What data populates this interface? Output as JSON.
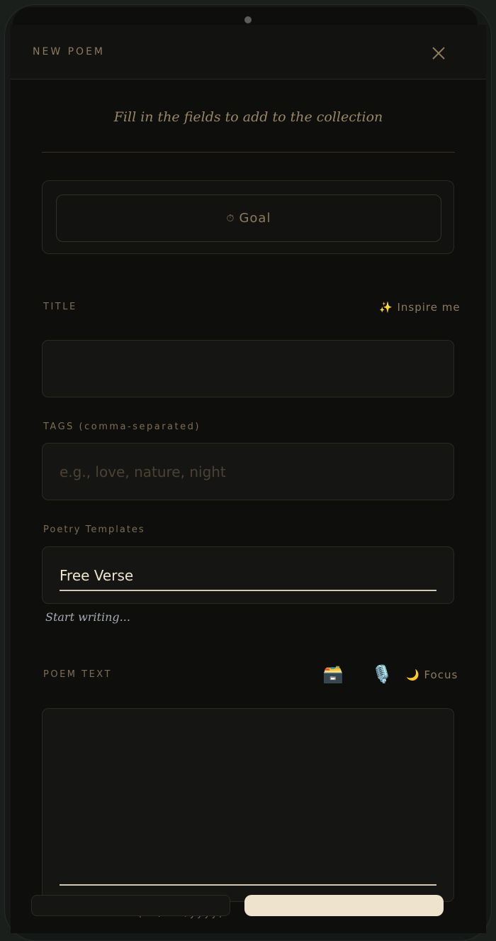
{
  "header": {
    "title": "NEW POEM",
    "close_icon": "close-icon"
  },
  "subtitle": "Fill in the fields to add to the collection",
  "goal": {
    "label": "Goal",
    "icon": "timer-icon",
    "glyph": "⏱"
  },
  "title_field": {
    "label": "TITLE",
    "value": "",
    "placeholder": "",
    "inspire_label": "Inspire me",
    "inspire_glyph": "✨"
  },
  "tags_field": {
    "label": "TAGS (comma-separated)",
    "value": "",
    "placeholder": "e.g., love, nature, night"
  },
  "templates": {
    "label": "Poetry Templates",
    "selected": "Free Verse",
    "hint": "Start writing..."
  },
  "poem_text": {
    "label": "POEM TEXT",
    "archive_glyph": "🗃️",
    "mic_glyph": "🎙️",
    "focus_glyph": "🌙",
    "focus_label": "Focus",
    "value": ""
  },
  "date_field": {
    "label": "DATE WRITTEN (dd/mm/yyyy)"
  },
  "colors": {
    "background": "#0e0e0d",
    "accent": "#8c7a5e",
    "primary_button": "#eee4cd"
  }
}
